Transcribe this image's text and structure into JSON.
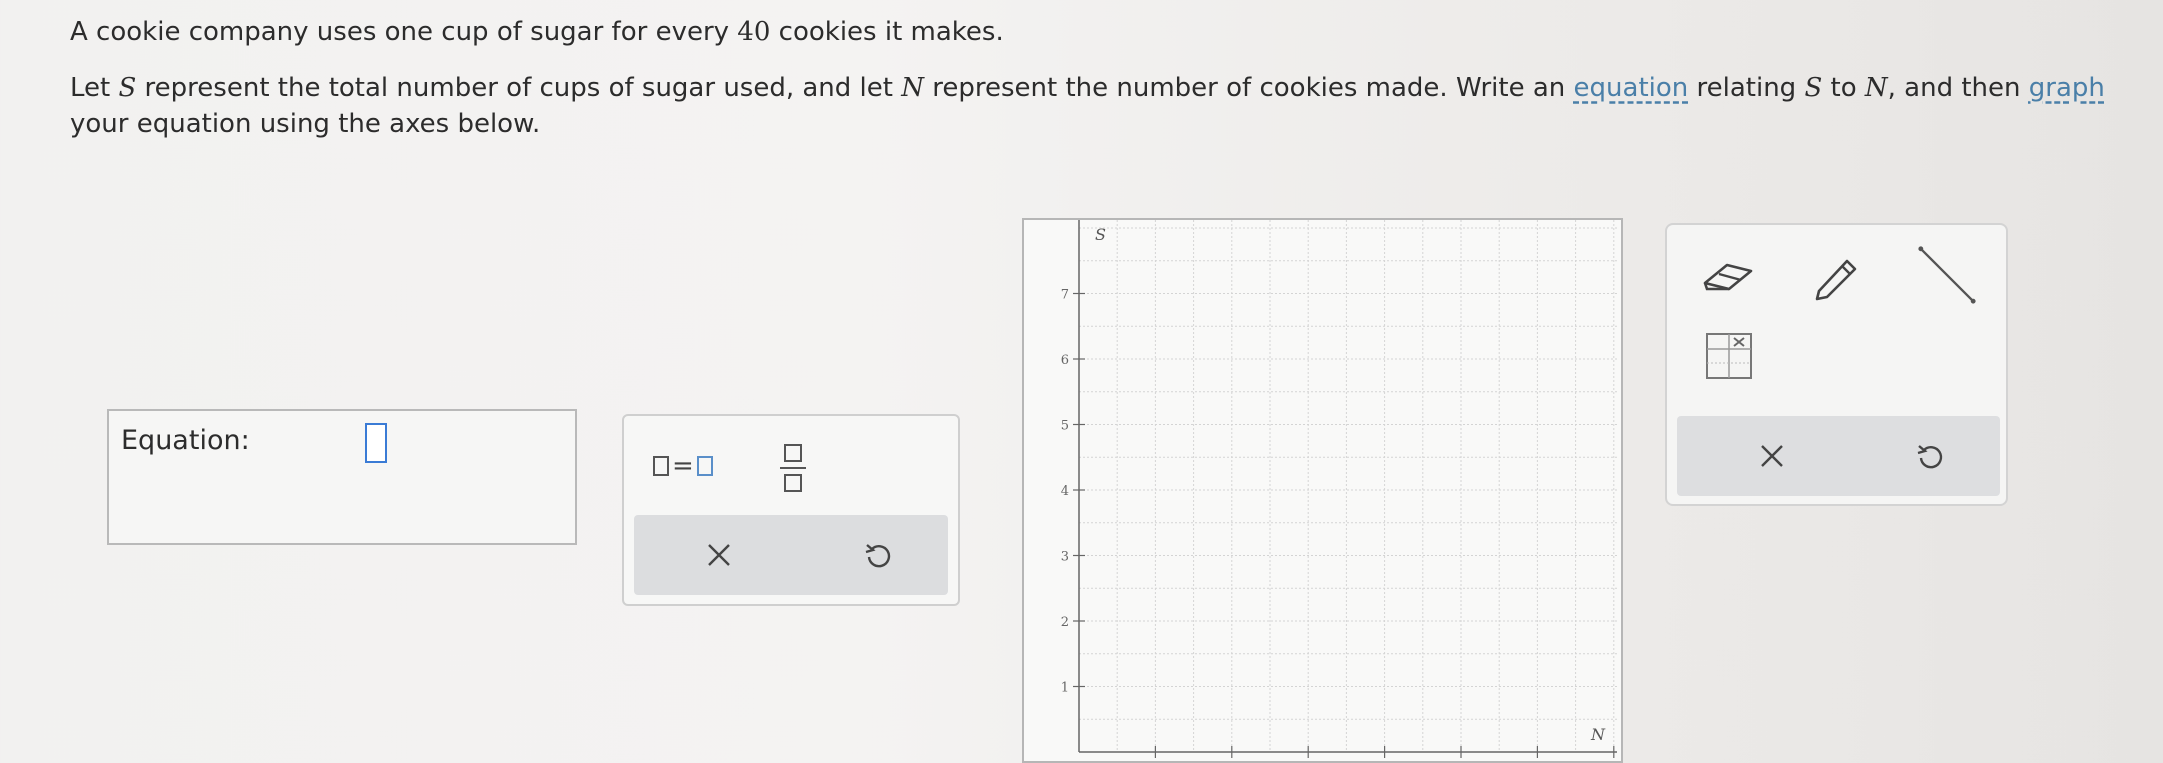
{
  "problem": {
    "line1_a": "A cookie company uses one cup of sugar for every ",
    "line1_num": "40",
    "line1_b": " cookies it makes.",
    "line2_a": "Let ",
    "var_s": "S",
    "line2_b": " represent the total number of cups of sugar used, and let ",
    "var_n": "N",
    "line2_c": " represent the number of cookies made. Write an ",
    "link_equation": "equation",
    "line2_d": " relating ",
    "line2_e": " to ",
    "line2_f": ", and then ",
    "link_graph": "graph",
    "line2_g": " your equation using the axes below."
  },
  "equation": {
    "label": "Equation:",
    "value": ""
  },
  "equation_tools": {
    "equals_symbol": "=",
    "insert_equals_icon": "box-equals-box-icon",
    "insert_fraction_icon": "fraction-icon",
    "clear_icon": "x-icon",
    "undo_icon": "undo-icon"
  },
  "graph": {
    "y_axis_label": "S",
    "x_axis_label": "N",
    "y_ticks": [
      "1",
      "2",
      "3",
      "4",
      "5",
      "6",
      "7"
    ],
    "grid": true
  },
  "graph_tools": {
    "eraser_icon": "eraser-icon",
    "pencil_icon": "pencil-icon",
    "line_icon": "line-segment-icon",
    "table_icon": "xy-table-icon",
    "clear_icon": "x-icon",
    "undo_icon": "undo-icon"
  },
  "colors": {
    "link": "#4a7fa8",
    "input_border": "#3a7bd5",
    "action_bar": "#dcdddf"
  }
}
